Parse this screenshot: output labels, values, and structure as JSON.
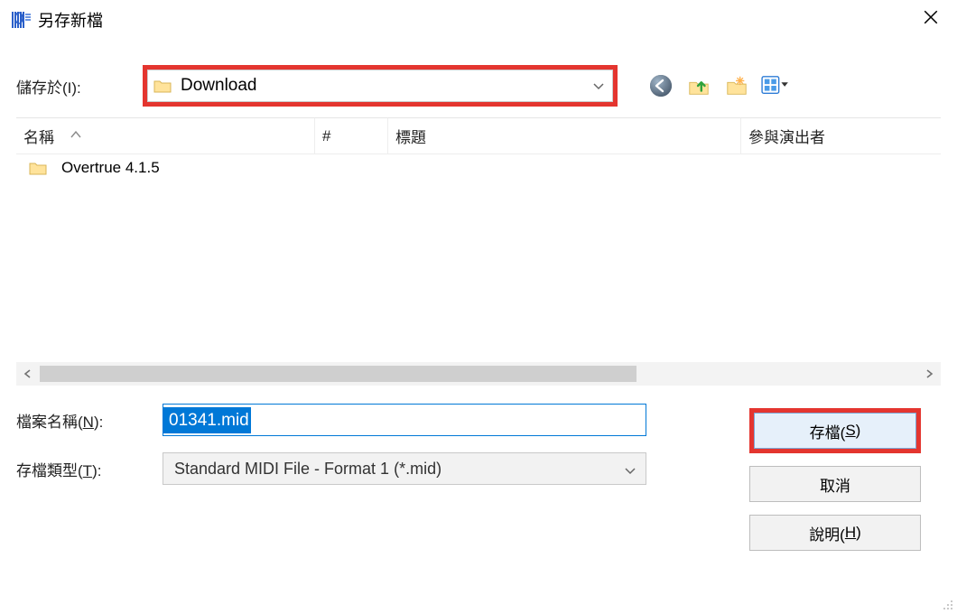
{
  "title": "另存新檔",
  "labels": {
    "save_in": "儲存於(I):",
    "filename": "檔案名稱(N):",
    "filetype": "存檔類型(T):"
  },
  "folder": {
    "name": "Download"
  },
  "columns": {
    "name": "名稱",
    "num": "#",
    "title": "標題",
    "artist": "參與演出者"
  },
  "items": [
    {
      "name": "Overtrue 4.1.5"
    }
  ],
  "filename": "01341.mid",
  "filetype": "Standard MIDI File - Format 1 (*.mid)",
  "buttons": {
    "save": "存檔(S)",
    "cancel": "取消",
    "help": "說明(H)"
  },
  "toolbar_icons": [
    "back-icon",
    "up-icon",
    "new-folder-icon",
    "views-icon"
  ]
}
